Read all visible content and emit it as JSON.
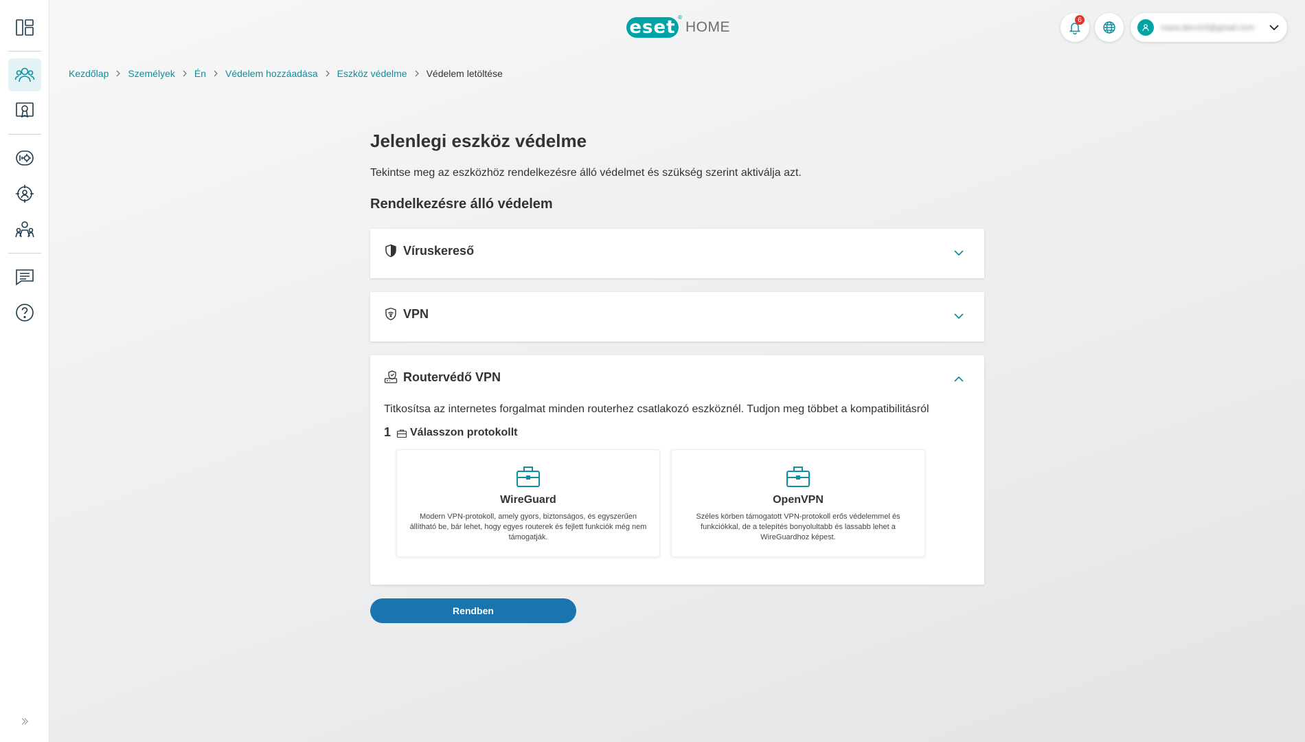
{
  "header": {
    "logo_text": "eset",
    "logo_suffix": "HOME",
    "notification_count": "6",
    "account_email": "mara.deccir3@gmail.com"
  },
  "sidebar": {
    "items": [
      {
        "name": "dashboard",
        "icon": "dashboard-icon"
      },
      {
        "name": "people",
        "icon": "people-icon",
        "active": true
      },
      {
        "name": "licenses",
        "icon": "license-icon"
      },
      {
        "name": "devices",
        "icon": "device-gear-icon"
      },
      {
        "name": "anti-theft",
        "icon": "anti-theft-icon"
      },
      {
        "name": "family",
        "icon": "family-icon"
      },
      {
        "name": "feedback",
        "icon": "chat-icon"
      },
      {
        "name": "help",
        "icon": "help-icon"
      }
    ],
    "expand_icon": "double-chevron-right-icon"
  },
  "breadcrumb": {
    "items": [
      "Kezdőlap",
      "Személyek",
      "Én",
      "Védelem hozzáadása",
      "Eszköz védelme"
    ],
    "current": "Védelem letöltése"
  },
  "main": {
    "title": "Jelenlegi eszköz védelme",
    "intro": "Tekintse meg az eszközhöz rendelkezésre álló védelmet és szükség szerint aktiválja azt.",
    "section_title": "Rendelkezésre álló védelem",
    "panels": [
      {
        "title": "Víruskereső",
        "icon": "shield-icon",
        "expanded": false
      },
      {
        "title": "VPN",
        "icon": "vpn-shield-icon",
        "expanded": false
      },
      {
        "title": "Routervédő VPN",
        "icon": "router-shield-icon",
        "expanded": true
      }
    ],
    "router_vpn": {
      "description": "Titkosítsa az internetes forgalmat minden routerhez csatlakozó eszköznél. Tudjon meg többet a kompatibilitásról",
      "step_number": "1",
      "step_label": "Válasszon protokollt",
      "protocols": [
        {
          "name": "WireGuard",
          "description": "Modern VPN-protokoll, amely gyors, biztonságos, és egyszerűen állítható be, bár lehet, hogy egyes routerek és fejlett funkciók még nem támogatják."
        },
        {
          "name": "OpenVPN",
          "description": "Széles körben támogatott VPN-protokoll erős védelemmel és funkciókkal, de a telepítés bonyolultabb és lassabb lehet a WireGuardhoz képest."
        }
      ]
    },
    "ok_button": "Rendben"
  },
  "colors": {
    "accent": "#00a3a6",
    "link": "#0e8fa0",
    "primary_button": "#1a74ad",
    "badge": "#e5342d"
  }
}
